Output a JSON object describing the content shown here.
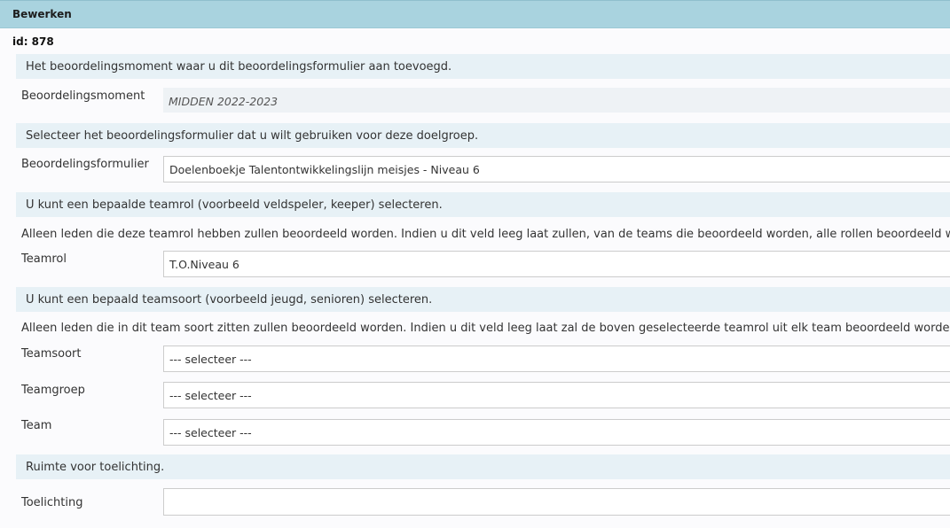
{
  "window": {
    "title": "Bewerken",
    "record_id": "id: 878"
  },
  "sections": {
    "moment": "Het beoordelingsmoment waar u dit beoordelingsformulier aan toevoegd.",
    "formulier": "Selecteer het beoordelingsformulier dat u wilt gebruiken voor deze doelgroep.",
    "teamrol": "U kunt een bepaalde teamrol (voorbeeld veldspeler, keeper) selecteren.",
    "teamsoort": "U kunt een bepaald teamsoort (voorbeeld jeugd, senioren) selecteren.",
    "toelichting": "Ruimte voor toelichting."
  },
  "notes": {
    "teamrol": "Alleen leden die deze teamrol hebben zullen beoordeeld worden. Indien u dit veld leeg laat zullen, van de teams die beoordeeld worden, alle rollen beoordeeld worden.",
    "teamsoort": "Alleen leden die in dit team soort zitten zullen beoordeeld worden. Indien u dit veld leeg laat zal de boven geselecteerde teamrol uit elk team beoordeeld worden."
  },
  "fields": {
    "beoordelingsmoment": {
      "label": "Beoordelingsmoment",
      "value": "MIDDEN 2022-2023"
    },
    "beoordelingsformulier": {
      "label": "Beoordelingsformulier",
      "value": "Doelenboekje Talentontwikkelingslijn meisjes - Niveau 6"
    },
    "teamrol": {
      "label": "Teamrol",
      "value": "T.O.Niveau 6"
    },
    "teamsoort": {
      "label": "Teamsoort",
      "value": "--- selecteer ---"
    },
    "teamgroep": {
      "label": "Teamgroep",
      "value": "--- selecteer ---"
    },
    "team": {
      "label": "Team",
      "value": "--- selecteer ---"
    },
    "toelichting": {
      "label": "Toelichting",
      "value": ""
    }
  }
}
